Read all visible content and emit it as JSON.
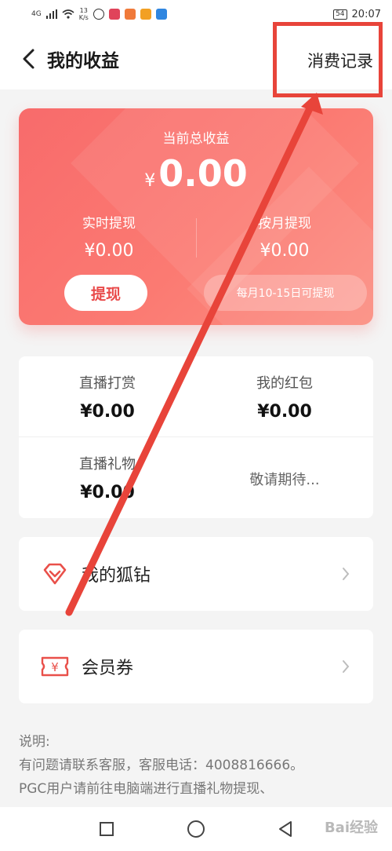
{
  "status_bar": {
    "network": "4G",
    "speed_value": "13",
    "speed_unit": "K/s",
    "battery": "54",
    "time": "20:07"
  },
  "header": {
    "title": "我的收益",
    "consume_record": "消费记录"
  },
  "earnings": {
    "total_label": "当前总收益",
    "currency": "¥",
    "total_value": "0.00",
    "realtime_label": "实时提现",
    "realtime_value": "¥0.00",
    "monthly_label": "按月提现",
    "monthly_value": "¥0.00",
    "withdraw_button": "提现",
    "monthly_note": "每月10-15日可提现"
  },
  "stats": {
    "live_tips_label": "直播打赏",
    "live_tips_value": "¥0.00",
    "red_packet_label": "我的红包",
    "red_packet_value": "¥0.00",
    "live_gift_label": "直播礼物",
    "live_gift_value": "¥0.00",
    "coming_soon": "敬请期待..."
  },
  "menu": {
    "fox_diamond": "我的狐钻",
    "coupon": "会员券",
    "coupon_icon_text": "¥"
  },
  "notes": {
    "title": "说明:",
    "line1": "有问题请联系客服，客服电话：4008816666。",
    "line2": "PGC用户请前往电脑端进行直播礼物提现、"
  },
  "watermark": "Bai经验",
  "colors": {
    "card_gradient_start": "#f86b6b",
    "card_gradient_end": "#fb8e82",
    "accent_red": "#e94b4b",
    "annotation_red": "#e8443a"
  }
}
